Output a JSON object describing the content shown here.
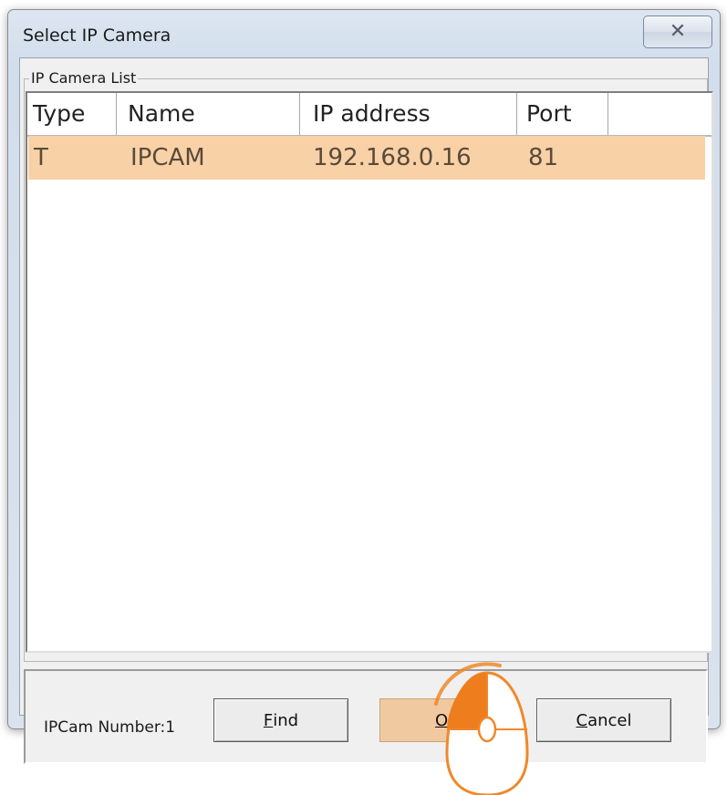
{
  "window": {
    "title": "Select IP Camera",
    "close_glyph": "✕"
  },
  "group": {
    "label": "IP Camera List"
  },
  "list": {
    "columns": [
      "Type",
      "Name",
      "IP address",
      "Port"
    ],
    "rows": [
      {
        "type": "T",
        "name": "IPCAM",
        "ip": "192.168.0.16",
        "port": "81"
      }
    ]
  },
  "footer": {
    "camera_number": "IPCam Number:1",
    "find_label": {
      "mnemonic": "F",
      "rest": "ind"
    },
    "ok_label": {
      "mnemonic": "O",
      "rest": "K"
    },
    "cancel_label": {
      "mnemonic": "C",
      "rest": "ancel"
    }
  },
  "colors": {
    "selection": "#f8d1a6",
    "ok_highlight": "#f1c9a0",
    "cursor_accent": "#f0882a"
  },
  "icons": {
    "close": "close-icon",
    "click_indicator": "mouse-click-icon"
  }
}
